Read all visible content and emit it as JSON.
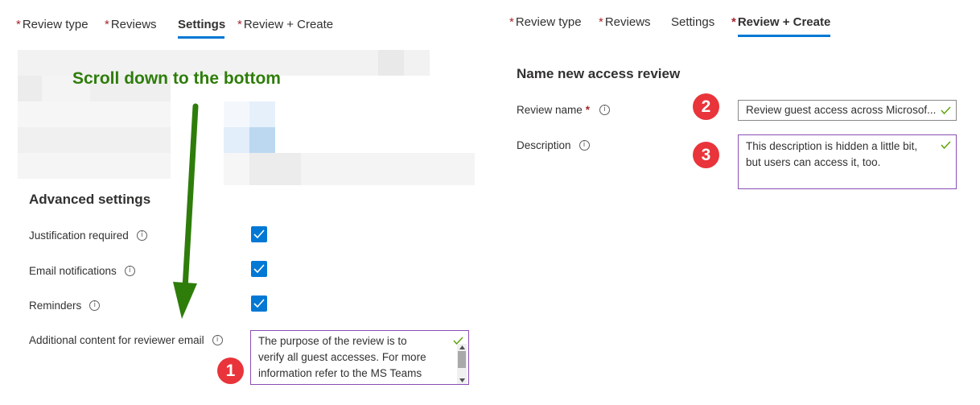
{
  "left_panel": {
    "tabs": [
      {
        "label": "Review type",
        "required": true
      },
      {
        "label": "Reviews",
        "required": true
      },
      {
        "label": "Settings",
        "required": false,
        "active": true
      },
      {
        "label": "Review + Create",
        "required": true
      }
    ],
    "annotation": "Scroll down to the bottom",
    "advanced": {
      "title": "Advanced settings",
      "justification_label": "Justification required",
      "justification_checked": true,
      "email_notifications_label": "Email notifications",
      "email_notifications_checked": true,
      "reminders_label": "Reminders",
      "reminders_checked": true,
      "additional_label": "Additional content for reviewer email",
      "additional_lines": [
        "The purpose of the review is to",
        "verify all guest accesses. For more",
        "information refer to the MS Teams"
      ]
    },
    "badge": "1"
  },
  "right_panel": {
    "tabs": [
      {
        "label": "Review type",
        "required": true
      },
      {
        "label": "Reviews",
        "required": true
      },
      {
        "label": "Settings",
        "required": false
      },
      {
        "label": "Review + Create",
        "required": true,
        "active": true
      }
    ],
    "title": "Name new access review",
    "review_name_label": "Review name",
    "review_name_value": "Review guest access across Microsof...",
    "description_label": "Description",
    "description_lines": [
      "This description is hidden a little bit,",
      "but users can access it, too."
    ],
    "badge_2": "2",
    "badge_3": "3"
  },
  "symbols": {
    "required_mark": "*",
    "info_glyph": "i"
  },
  "colors": {
    "accent": "#0078d4",
    "annotation_green": "#2e7d0a",
    "badge_red": "#e8343a",
    "required_red": "#a4262c",
    "field_border": "#8a4fb5"
  },
  "icons": [
    "info-icon",
    "checkmark-icon",
    "green-arrow-icon",
    "scroll-up-icon",
    "scroll-down-icon"
  ]
}
